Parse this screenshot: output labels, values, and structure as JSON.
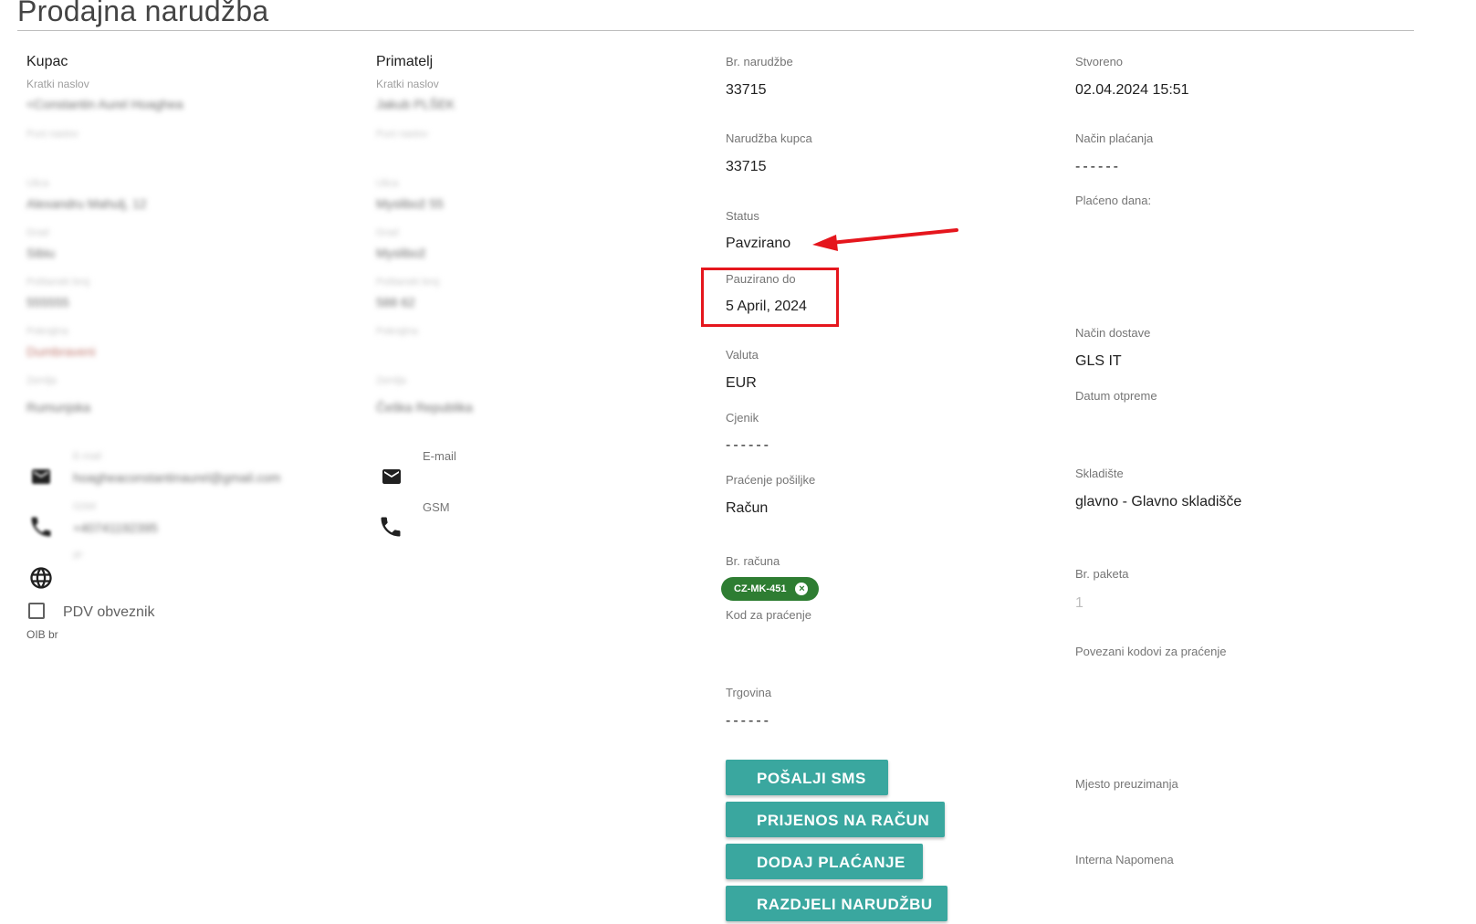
{
  "page": {
    "title": "Prodajna narudžba"
  },
  "customer": {
    "header": "Kupac",
    "short_title_label": "Kratki naslov",
    "short_title": "<Constantin Aurel Hoaghea",
    "full_title_label": "Puni naslov",
    "street_label": "Ulica",
    "street": "Alexandru Mahulj, 12",
    "city_label": "Grad",
    "city": "Sibiu",
    "postal_label": "Poštanski broj",
    "postal": "555555",
    "region_label": "Pokrajina",
    "region": "Dumbraveni",
    "country_label": "Zemlja",
    "country": "Rumunjska",
    "email_label": "E-mail",
    "email": "hoagheaconstantinaurel@gmail.com",
    "gsm_label": "GSM",
    "gsm": "+40741192395",
    "ip_label": "IP",
    "vat_label": "PDV obveznik",
    "oib_label": "OIB br"
  },
  "recipient": {
    "header": "Primatelj",
    "short_title_label": "Kratki naslov",
    "short_title": "Jakub PLŠEK",
    "full_title_label": "Puni naslov",
    "street_label": "Ulica",
    "street": "Myslibož 55",
    "city_label": "Grad",
    "city": "Myslibož",
    "postal_label": "Poštanski broj",
    "postal": "588 62",
    "region_label": "Pokrajina",
    "country_label": "Zemlja",
    "country": "Češka Republika",
    "email_label": "E-mail",
    "gsm_label": "GSM"
  },
  "order": {
    "order_no_label": "Br. narudžbe",
    "order_no": "33715",
    "customer_order_label": "Narudžba kupca",
    "customer_order": "33715",
    "status_label": "Status",
    "status": "Pavzirano",
    "paused_until_label": "Pauzirano do",
    "paused_until": "5 April, 2024",
    "currency_label": "Valuta",
    "currency": "EUR",
    "pricelist_label": "Cjenik",
    "pricelist": "------",
    "tracking_label": "Praćenje pošiljke",
    "tracking": "Račun",
    "invoice_no_label": "Br. računa",
    "invoice_chip": "CZ-MK-451",
    "tracking_code_label": "Kod za praćenje",
    "store_label": "Trgovina",
    "store": "------"
  },
  "meta": {
    "created_label": "Stvoreno",
    "created": "02.04.2024 15:51",
    "payment_method_label": "Način plaćanja",
    "payment_method": "------",
    "paid_on_label": "Plaćeno dana:",
    "delivery_method_label": "Način dostave",
    "delivery_method": "GLS IT",
    "ship_date_label": "Datum otpreme",
    "warehouse_label": "Skladište",
    "warehouse": "glavno - Glavno skladišče",
    "packages_label": "Br. paketa",
    "packages": "1",
    "linked_codes_label": "Povezani kodovi za praćenje",
    "pickup_label": "Mjesto preuzimanja",
    "internal_note_label": "Interna Napomena"
  },
  "actions": {
    "send_sms": "POŠALJI SMS",
    "transfer_invoice": "PRIJENOS NA RAČUN",
    "add_payment": "DODAJ PLAĆANJE",
    "split_order": "RAZDJELI NARUDŽBU"
  },
  "annotation": {
    "color": "#e5161d"
  }
}
